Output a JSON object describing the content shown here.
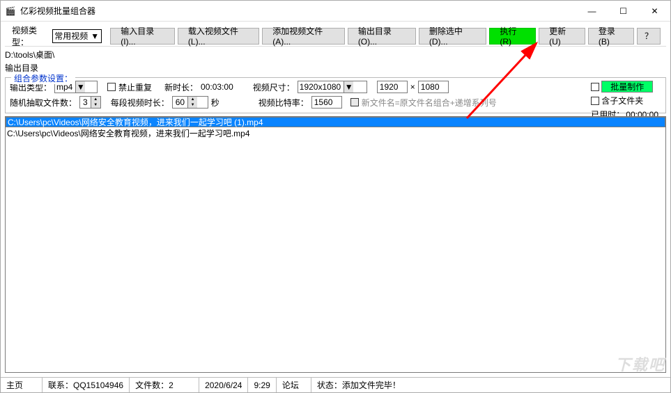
{
  "window": {
    "title": "亿彩视频批量组合器"
  },
  "winbtns": {
    "min": "—",
    "max": "☐",
    "close": "✕"
  },
  "toolbar": {
    "typeLabel": "视频类型：",
    "typeValue": "常用视频",
    "btnInputDir": "输入目录(I)...",
    "btnLoad": "载入视频文件(L)...",
    "btnAdd": "添加视频文件(A)...",
    "btnOutputDir": "输出目录(O)...",
    "btnDelSel": "删除选中(D)...",
    "btnExec": "执行(R)",
    "btnUpdate": "更新(U)",
    "btnLogin": "登录(B)",
    "btnHelp": "？"
  },
  "paths": {
    "inputDir": "D:\\tools\\桌面\\",
    "outputDirLabel": "输出目录"
  },
  "params": {
    "legend": "组合参数设置：",
    "outTypeLabel": "输出类型：",
    "outTypeVal": "mp4",
    "noRepeatLabel": "禁止重复",
    "newDurLabel": "新时长：",
    "newDurVal": "00:03:00",
    "sizeLabel": "视频尺寸：",
    "sizeVal": "1920x1080",
    "w": "1920",
    "h": "1080",
    "x": "×",
    "randLabel": "随机抽取文件数：",
    "randVal": "3",
    "segLabel": "每段视频时长：",
    "segVal": "60",
    "segUnit": "秒",
    "brLabel": "视频比特率：",
    "brVal": "1560",
    "newNameLabel": "新文件名=原文件名组合+递增系列号",
    "batchBtn": "批量制作",
    "subfolderLabel": "含子文件夹",
    "elapsedLabel": "已用时：",
    "elapsedVal": "00:00:00"
  },
  "files": [
    "C:\\Users\\pc\\Videos\\网络安全教育视频，进来我们一起学习吧 (1).mp4",
    "C:\\Users\\pc\\Videos\\网络安全教育视频，进来我们一起学习吧.mp4"
  ],
  "status": {
    "home": "主页",
    "contact": "联系：QQ15104946",
    "fileCount": "文件数：2",
    "date": "2020/6/24",
    "time": "9:29",
    "forum": "论坛",
    "state": "状态：添加文件完毕！"
  },
  "watermark": "下载吧"
}
